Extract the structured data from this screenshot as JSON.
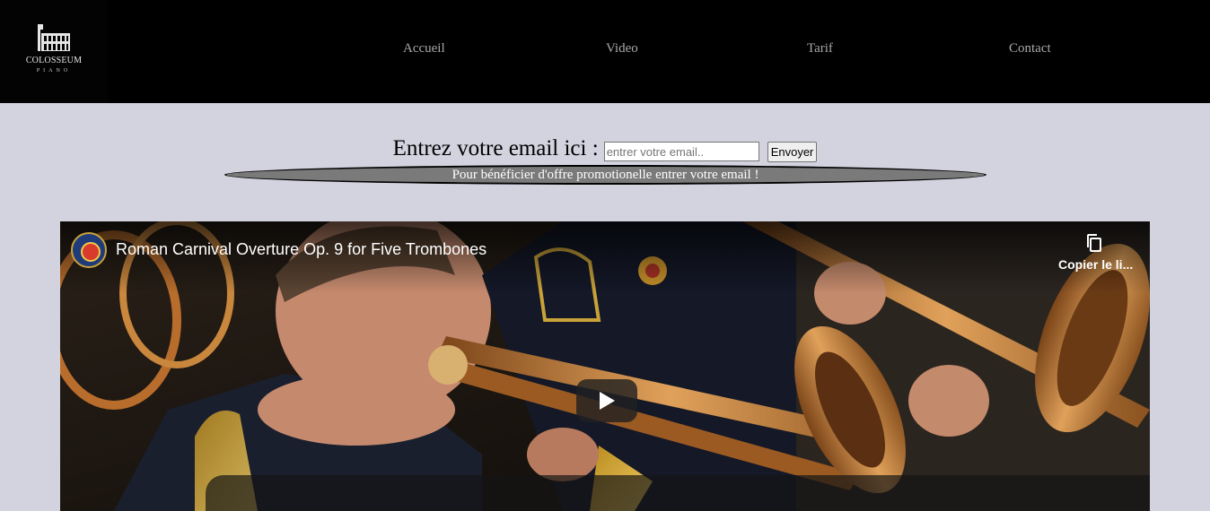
{
  "header": {
    "logo": {
      "name": "COLOSSEUM",
      "sub": "PIANO",
      "icon": "colosseum-icon"
    },
    "nav": [
      {
        "label": "Accueil"
      },
      {
        "label": "Video"
      },
      {
        "label": "Tarif"
      },
      {
        "label": "Contact"
      }
    ]
  },
  "newsletter": {
    "label": "Entrez votre email ici :",
    "input_placeholder": "entrer votre email..",
    "input_value": "",
    "button_label": "Envoyer",
    "promo_text": "Pour bénéficier d'offre promotionelle entrer votre email !"
  },
  "video": {
    "title": "Roman Carnival Overture Op. 9 for Five Trombones",
    "copy_label": "Copier le li...",
    "icons": {
      "channel": "channel-logo-icon",
      "copy": "copy-icon",
      "play": "play-icon"
    }
  },
  "colors": {
    "header_bg": "#000000",
    "page_bg": "#d3d3e0",
    "nav_text": "#a9a9a9",
    "banner_bg": "#7a7a7a"
  }
}
